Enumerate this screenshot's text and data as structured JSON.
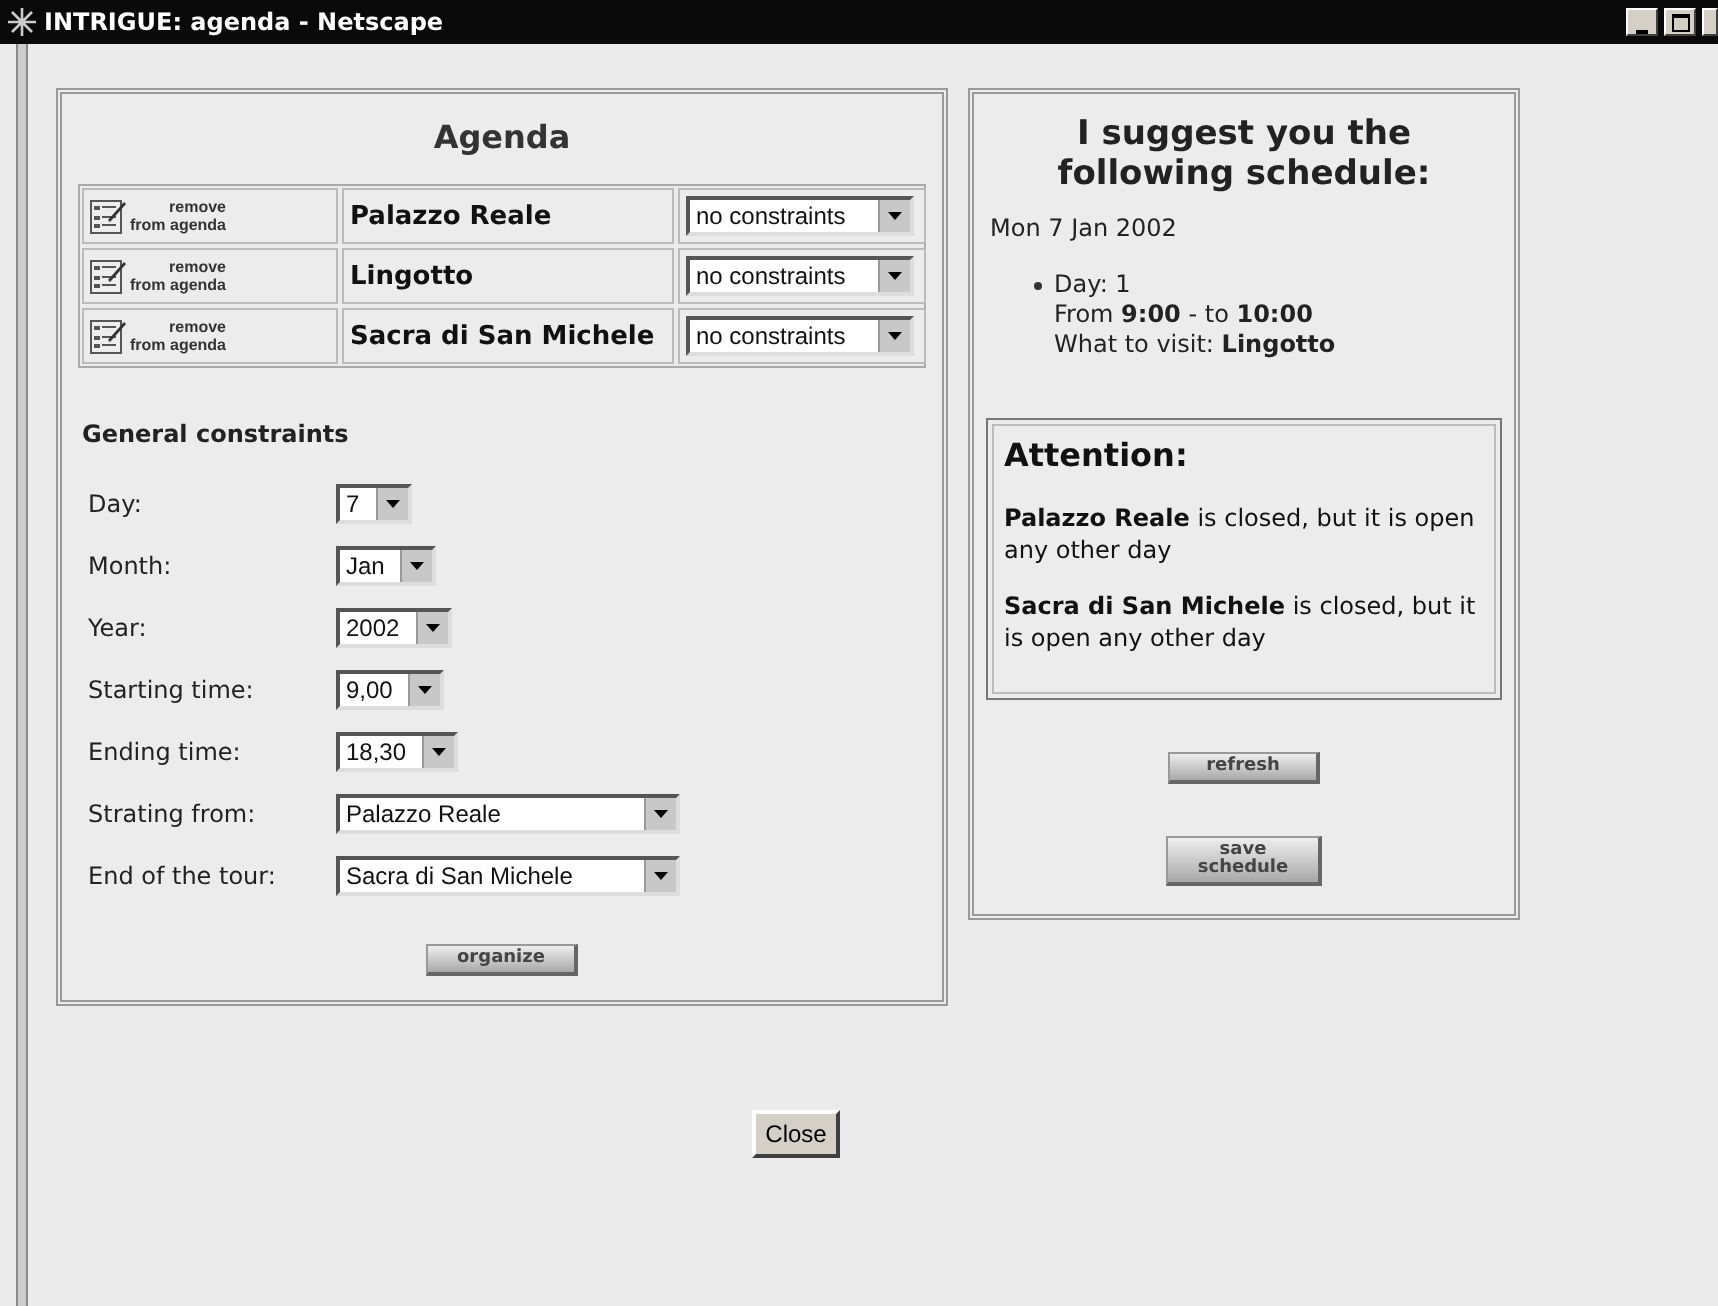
{
  "window": {
    "title": "INTRIGUE: agenda - Netscape"
  },
  "agenda": {
    "title": "Agenda",
    "items": [
      {
        "remove_top": "remove",
        "remove_bottom": "from agenda",
        "name": "Palazzo Reale",
        "constraint": "no constraints"
      },
      {
        "remove_top": "remove",
        "remove_bottom": "from agenda",
        "name": "Lingotto",
        "constraint": "no constraints"
      },
      {
        "remove_top": "remove",
        "remove_bottom": "from agenda",
        "name": "Sacra di San Michele",
        "constraint": "no constraints"
      }
    ]
  },
  "general_constraints": {
    "title": "General constraints",
    "fields": [
      {
        "label": "Day:",
        "value": "7",
        "kind": "narrow"
      },
      {
        "label": "Month:",
        "value": "Jan",
        "kind": "narrow"
      },
      {
        "label": "Year:",
        "value": "2002",
        "kind": "narrow"
      },
      {
        "label": "Starting time:",
        "value": "9,00",
        "kind": "narrow"
      },
      {
        "label": "Ending time:",
        "value": "18,30",
        "kind": "narrow"
      },
      {
        "label": "Strating from:",
        "value": "Palazzo Reale",
        "kind": "wide"
      },
      {
        "label": "End of the tour:",
        "value": "Sacra di San Michele",
        "kind": "wide"
      }
    ],
    "button": "organize"
  },
  "schedule": {
    "title": "I suggest you the following schedule:",
    "date": "Mon 7 Jan 2002",
    "items": [
      {
        "lines": [
          "Day: 1",
          "From **9:00** - to **10:00**",
          "What to visit: **Lingotto**"
        ]
      }
    ],
    "attention": {
      "title": "Attention:",
      "messages": [
        "**Palazzo Reale** is closed, but it is open any other day",
        "**Sacra di San Michele** is closed, but it is open any other day"
      ]
    },
    "buttons": [
      "refresh",
      "save schedule"
    ]
  },
  "close_button": "Close"
}
